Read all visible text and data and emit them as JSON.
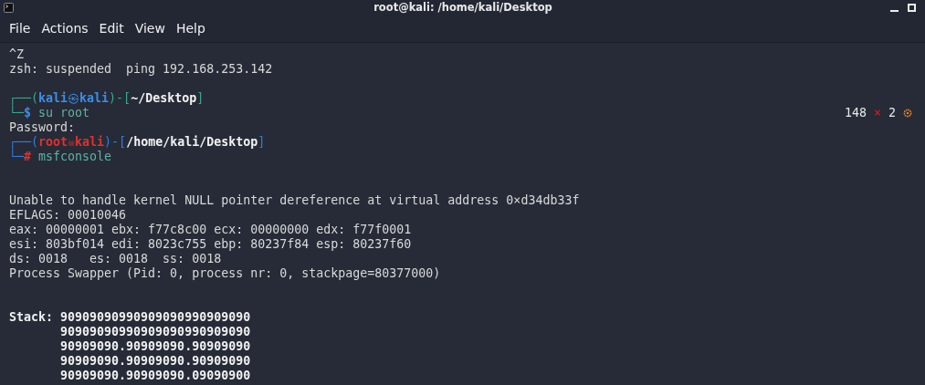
{
  "window": {
    "title": "root@kali: /home/kali/Desktop"
  },
  "menu": [
    {
      "label": "File"
    },
    {
      "label": "Actions"
    },
    {
      "label": "Edit"
    },
    {
      "label": "View"
    },
    {
      "label": "Help"
    }
  ],
  "terminal": {
    "lines": [
      {
        "kind": "text",
        "text": "^Z"
      },
      {
        "kind": "text",
        "text": "zsh: suspended  ping 192.168.253.142"
      },
      {
        "kind": "blank"
      },
      {
        "kind": "prompt",
        "root": false,
        "corner": "┌──(",
        "user": "kali",
        "at": "㉿",
        "host": "kali",
        "mid": ")-[",
        "path": "~/Desktop",
        "close": "]"
      },
      {
        "kind": "command",
        "root": false,
        "corner": "└─",
        "symbol": "$",
        "command": "su root",
        "status": {
          "count": "148",
          "mark": "×",
          "code": "2"
        }
      },
      {
        "kind": "text",
        "text": "Password:"
      },
      {
        "kind": "prompt",
        "root": true,
        "corner": "┌──(",
        "user": "root",
        "at": "☠",
        "host": "kali",
        "mid": ")-[",
        "path": "/home/kali/Desktop",
        "close": "]"
      },
      {
        "kind": "command",
        "root": true,
        "corner": "└─",
        "symbol": "#",
        "command": "msfconsole"
      },
      {
        "kind": "blank"
      },
      {
        "kind": "blank"
      },
      {
        "kind": "text",
        "text": "Unable to handle kernel NULL pointer dereference at virtual address 0×d34db33f"
      },
      {
        "kind": "text",
        "text": "EFLAGS: 00010046"
      },
      {
        "kind": "text",
        "text": "eax: 00000001 ebx: f77c8c00 ecx: 00000000 edx: f77f0001"
      },
      {
        "kind": "text",
        "text": "esi: 803bf014 edi: 8023c755 ebp: 80237f84 esp: 80237f60"
      },
      {
        "kind": "text",
        "text": "ds: 0018   es: 0018  ss: 0018"
      },
      {
        "kind": "text",
        "text": "Process Swapper (Pid: 0, process nr: 0, stackpage=80377000)"
      },
      {
        "kind": "blank"
      },
      {
        "kind": "blank"
      },
      {
        "kind": "bold",
        "text": "Stack: 90909090990909090990909090"
      },
      {
        "kind": "bold",
        "text": "       90909090990909090990909090"
      },
      {
        "kind": "bold",
        "text": "       90909090.90909090.90909090"
      },
      {
        "kind": "bold",
        "text": "       90909090.90909090.90909090"
      },
      {
        "kind": "bold",
        "text": "       90909090.90909090.09090900"
      }
    ]
  }
}
